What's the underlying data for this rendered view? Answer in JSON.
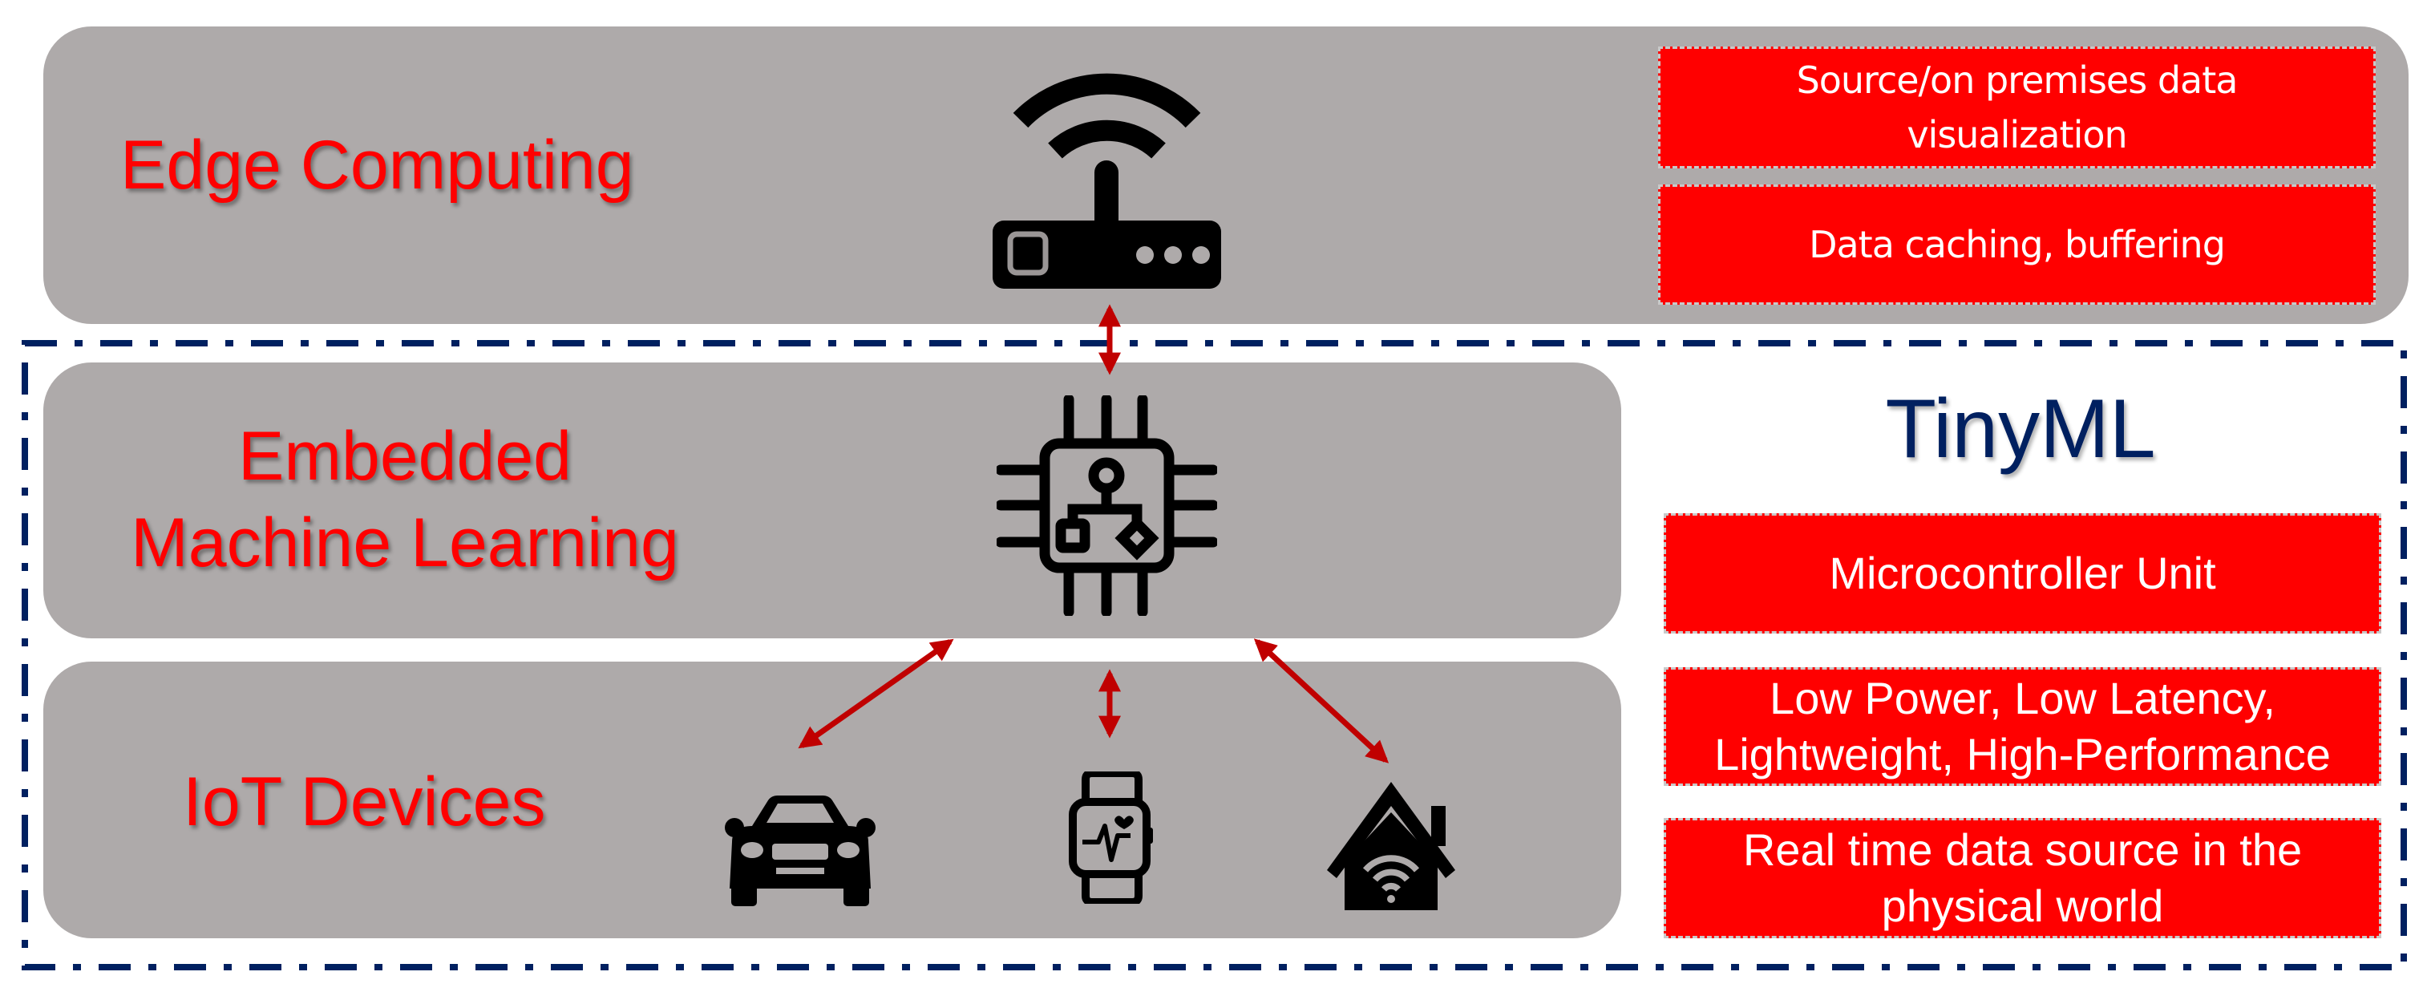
{
  "layers": {
    "edge": {
      "title": "Edge Computing"
    },
    "embedded": {
      "title_line1": "Embedded",
      "title_line2": "Machine Learning"
    },
    "iot": {
      "title": "IoT Devices"
    }
  },
  "edge_features": [
    {
      "line1": "Source/on premises data",
      "line2": "visualization"
    },
    {
      "line1": "Data caching, buffering"
    }
  ],
  "tinyml": {
    "title": "TinyML",
    "features": [
      {
        "line1": "Microcontroller Unit"
      },
      {
        "line1": "Low Power, Low Latency,",
        "line2": "Lightweight, High-Performance"
      },
      {
        "line1": "Real time data source in the",
        "line2": "physical world"
      }
    ]
  },
  "icons": {
    "edge": "wifi-router-icon",
    "embedded": "ml-chip-icon",
    "devices": [
      "car-icon",
      "smartwatch-icon",
      "smart-home-icon"
    ]
  },
  "colors": {
    "layer_bg": "#AEAAAA",
    "label_red": "#FF0000",
    "tinyml_navy": "#002060",
    "arrow_red": "#C00000"
  }
}
